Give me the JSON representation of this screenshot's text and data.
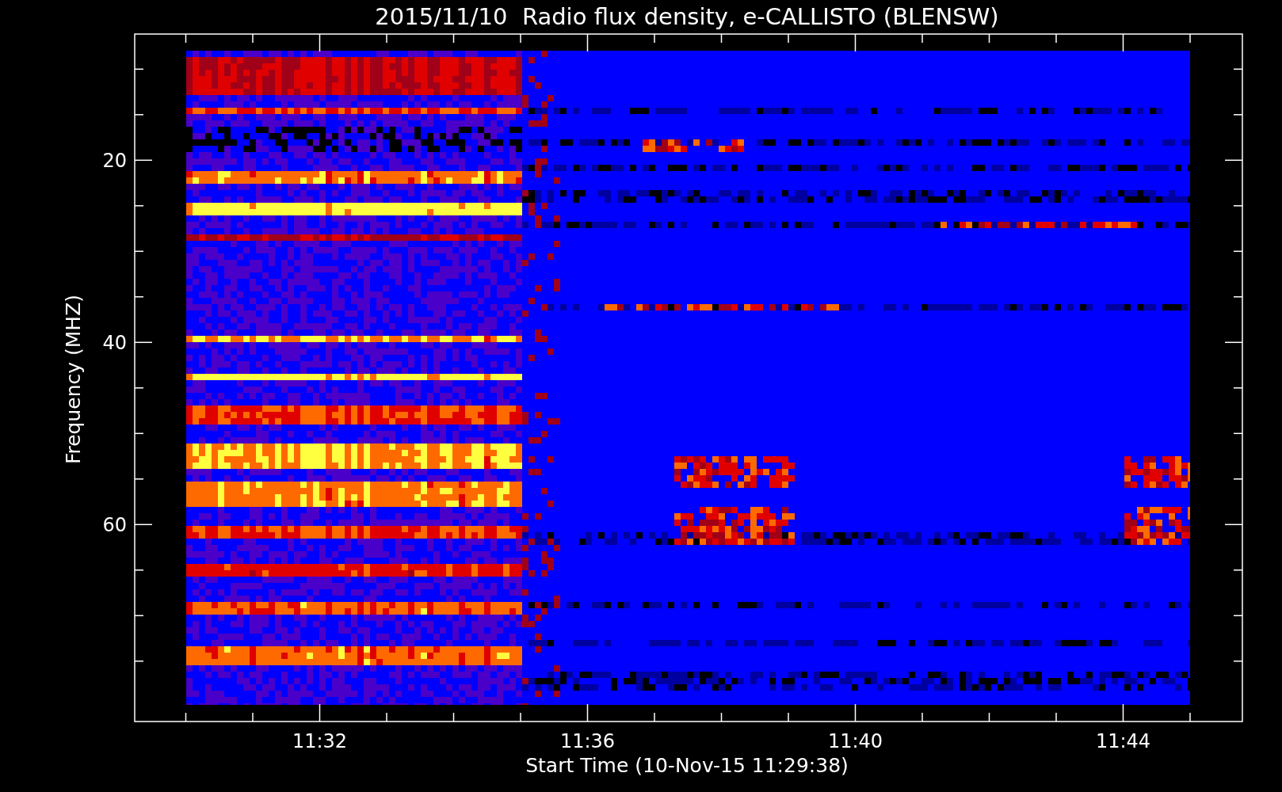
{
  "title": "2015/11/10  Radio flux density, e-CALLISTO (BLENSW)",
  "y_axis": {
    "label": "Frequency (MHZ)",
    "ticks": [
      "20",
      "40",
      "60"
    ]
  },
  "x_axis": {
    "label": "Start Time (10-Nov-15 11:29:38)",
    "ticks": [
      "11:32",
      "11:36",
      "11:40",
      "11:44"
    ]
  }
}
